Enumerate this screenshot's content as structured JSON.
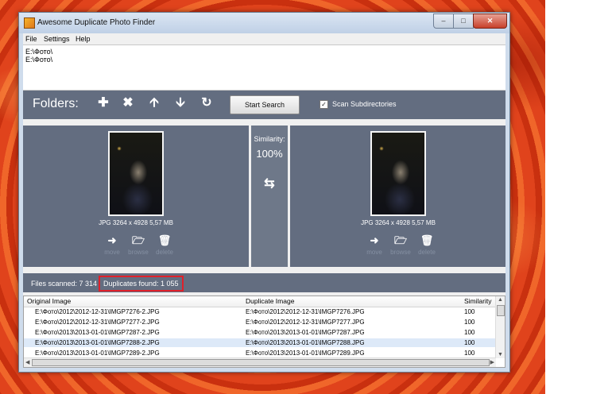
{
  "window": {
    "title": "Awesome Duplicate Photo Finder"
  },
  "menu": {
    "file": "File",
    "settings": "Settings",
    "help": "Help"
  },
  "folders": {
    "paths": [
      "E:\\Фото\\",
      "E:\\Фото\\"
    ]
  },
  "toolbar": {
    "folders_label": "Folders:",
    "start_search": "Start Search",
    "scan_subdirectories": "Scan Subdirectories",
    "scan_subdirectories_checked": true,
    "icons": [
      "add-icon",
      "remove-icon",
      "move-up-icon",
      "move-down-icon",
      "refresh-icon"
    ]
  },
  "left": {
    "info": "JPG  3264 x 4928  5,57 MB",
    "move": "move",
    "browse": "browse",
    "delete": "delete"
  },
  "right": {
    "info": "JPG  3264 x 4928  5,57 MB",
    "move": "move",
    "browse": "browse",
    "delete": "delete"
  },
  "similarity": {
    "label": "Similarity:",
    "value": "100%"
  },
  "status": {
    "files_scanned": "Files scanned: 7 314",
    "duplicates_found": "Duplicates found: 1 055"
  },
  "table": {
    "headers": [
      "Original Image",
      "Duplicate Image",
      "Similarity"
    ],
    "rows": [
      [
        "E:\\Фото\\2012\\2012-12-31\\IMGP7276-2.JPG",
        "E:\\Фото\\2012\\2012-12-31\\IMGP7276.JPG",
        "100"
      ],
      [
        "E:\\Фото\\2012\\2012-12-31\\IMGP7277-2.JPG",
        "E:\\Фото\\2012\\2012-12-31\\IMGP7277.JPG",
        "100"
      ],
      [
        "E:\\Фото\\2013\\2013-01-01\\IMGP7287-2.JPG",
        "E:\\Фото\\2013\\2013-01-01\\IMGP7287.JPG",
        "100"
      ],
      [
        "E:\\Фото\\2013\\2013-01-01\\IMGP7288-2.JPG",
        "E:\\Фото\\2013\\2013-01-01\\IMGP7288.JPG",
        "100"
      ],
      [
        "E:\\Фото\\2013\\2013-01-01\\IMGP7289-2.JPG",
        "E:\\Фото\\2013\\2013-01-01\\IMGP7289.JPG",
        "100"
      ]
    ],
    "selected_row": 3
  }
}
